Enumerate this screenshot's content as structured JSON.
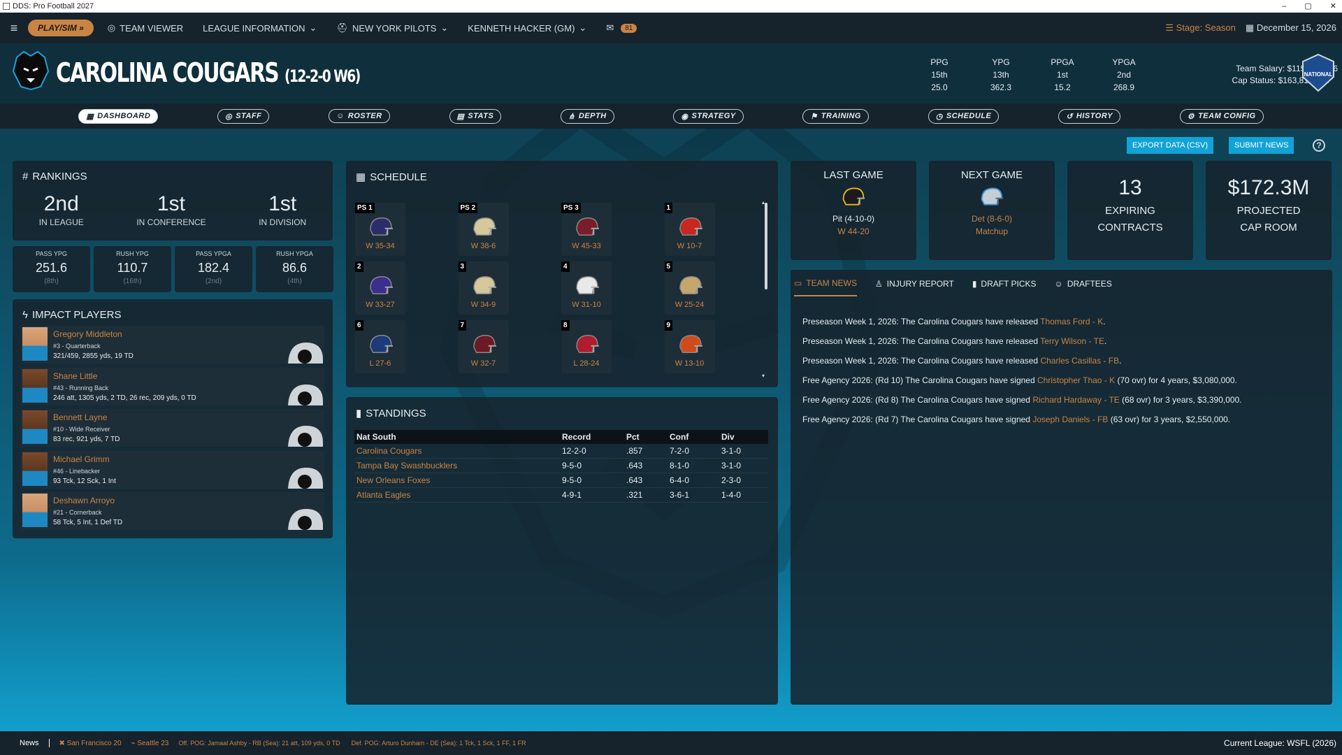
{
  "window": {
    "title": "DDS: Pro Football 2027"
  },
  "topnav": {
    "play_sim": "PLAY/SIM",
    "team_viewer": "TEAM VIEWER",
    "league_info": "LEAGUE INFORMATION",
    "user_team": "NEW YORK PILOTS",
    "gm": "KENNETH HACKER (GM)",
    "mail_count": "81",
    "stage": "Stage: Season",
    "date": "December 15, 2026"
  },
  "header": {
    "team_name": "CAROLINA COUGARS",
    "record": "(12-2-0 W6)",
    "stats": [
      {
        "label": "PPG",
        "rank": "15th",
        "value": "25.0"
      },
      {
        "label": "YPG",
        "rank": "13th",
        "value": "362.3"
      },
      {
        "label": "PPGA",
        "rank": "1st",
        "value": "15.2"
      },
      {
        "label": "YPGA",
        "rank": "2nd",
        "value": "268.9"
      }
    ],
    "team_salary": "Team Salary: $115,186,806",
    "cap_status": "Cap Status: $163,813,194",
    "conference_badge": "NATIONAL"
  },
  "subnav": [
    "DASHBOARD",
    "STAFF",
    "ROSTER",
    "STATS",
    "DEPTH",
    "STRATEGY",
    "TRAINING",
    "SCHEDULE",
    "HISTORY",
    "TEAM CONFIG"
  ],
  "actions": {
    "export": "EXPORT DATA (CSV)",
    "submit": "SUBMIT NEWS",
    "help": "?"
  },
  "rankings": {
    "title": "RANKINGS",
    "items": [
      {
        "value": "2nd",
        "label": "IN LEAGUE"
      },
      {
        "value": "1st",
        "label": "IN CONFERENCE"
      },
      {
        "value": "1st",
        "label": "IN DIVISION"
      }
    ],
    "mini": [
      {
        "label": "PASS YPG",
        "value": "251.6",
        "rank": "(8th)"
      },
      {
        "label": "RUSH YPG",
        "value": "110.7",
        "rank": "(16th)"
      },
      {
        "label": "PASS YPGA",
        "value": "182.4",
        "rank": "(2nd)"
      },
      {
        "label": "RUSH YPGA",
        "value": "86.6",
        "rank": "(4th)"
      }
    ]
  },
  "impact": {
    "title": "IMPACT PLAYERS",
    "players": [
      {
        "name": "Gregory Middleton",
        "pos": "#3 - Quarterback",
        "stats": "321/459, 2855 yds, 19 TD"
      },
      {
        "name": "Shane Little",
        "pos": "#43 - Running Back",
        "stats": "246 att, 1305 yds, 2 TD, 26 rec, 209 yds, 0 TD"
      },
      {
        "name": "Bennett Layne",
        "pos": "#10 - Wide Receiver",
        "stats": "83 rec, 921 yds, 7 TD"
      },
      {
        "name": "Michael Grimm",
        "pos": "#46 - Linebacker",
        "stats": "93 Tck, 12 Sck, 1 Int"
      },
      {
        "name": "Deshawn Arroyo",
        "pos": "#21 - Cornerback",
        "stats": "58 Tck, 5 Int, 1 Def TD"
      }
    ]
  },
  "schedule": {
    "title": "SCHEDULE",
    "games": [
      {
        "wk": "PS 1",
        "res": "W 35-34",
        "c": "#2b2d6b"
      },
      {
        "wk": "PS 2",
        "res": "W 38-6",
        "c": "#d5c89a"
      },
      {
        "wk": "PS 3",
        "res": "W 45-33",
        "c": "#7a1d2a"
      },
      {
        "wk": "1",
        "res": "W 10-7",
        "c": "#c8281e"
      },
      {
        "wk": "2",
        "res": "W 33-27",
        "c": "#3c2e8f"
      },
      {
        "wk": "3",
        "res": "W 34-9",
        "c": "#d5c89a"
      },
      {
        "wk": "4",
        "res": "W 31-10",
        "c": "#e9e9e9"
      },
      {
        "wk": "5",
        "res": "W 25-24",
        "c": "#c7a66b"
      },
      {
        "wk": "6",
        "res": "L 27-6",
        "c": "#1d3a7a"
      },
      {
        "wk": "7",
        "res": "W 32-7",
        "c": "#6b1a26"
      },
      {
        "wk": "8",
        "res": "L 28-24",
        "c": "#b01c2e"
      },
      {
        "wk": "9",
        "res": "W 13-10",
        "c": "#d14a1c"
      }
    ]
  },
  "standings": {
    "title": "STANDINGS",
    "headers": [
      "Nat South",
      "Record",
      "Pct",
      "Conf",
      "Div"
    ],
    "rows": [
      [
        "Carolina Cougars",
        "12-2-0",
        ".857",
        "7-2-0",
        "3-1-0"
      ],
      [
        "Tampa Bay Swashbucklers",
        "9-5-0",
        ".643",
        "8-1-0",
        "3-1-0"
      ],
      [
        "New Orleans Foxes",
        "9-5-0",
        ".643",
        "6-4-0",
        "2-3-0"
      ],
      [
        "Atlanta Eagles",
        "4-9-1",
        ".321",
        "3-6-1",
        "1-4-0"
      ]
    ]
  },
  "last_game": {
    "title": "LAST GAME",
    "team": "Pit (4-10-0)",
    "result": "W 44-20"
  },
  "next_game": {
    "title": "NEXT GAME",
    "team": "Det (8-6-0)",
    "link": "Matchup"
  },
  "expiring": {
    "value": "13",
    "line1": "EXPIRING",
    "line2": "CONTRACTS"
  },
  "cap_room": {
    "value": "$172.3M",
    "line1": "PROJECTED",
    "line2": "CAP ROOM"
  },
  "news_tabs": [
    "TEAM NEWS",
    "INJURY REPORT",
    "DRAFT PICKS",
    "DRAFTEES"
  ],
  "news": [
    {
      "pre": "Preseason Week 1, 2026: The Carolina Cougars have released ",
      "link": "Thomas Ford - K",
      "post": "."
    },
    {
      "pre": "Preseason Week 1, 2026: The Carolina Cougars have released ",
      "link": "Terry Wilson - TE",
      "post": "."
    },
    {
      "pre": "Preseason Week 1, 2026: The Carolina Cougars have released ",
      "link": "Charles Casillas - FB",
      "post": "."
    },
    {
      "pre": "Free Agency 2026: (Rd 10) The Carolina Cougars have signed ",
      "link": "Christopher Thao - K",
      "post": " (70 ovr) for 4 years, $3,080,000."
    },
    {
      "pre": "Free Agency 2026: (Rd 8) The Carolina Cougars have signed ",
      "link": "Richard Hardaway - TE",
      "post": " (68 ovr) for 3 years, $3,390,000."
    },
    {
      "pre": "Free Agency 2026: (Rd 7) The Carolina Cougars have signed ",
      "link": "Joseph Daniels - FB",
      "post": " (63 ovr) for 3 years, $2,550,000."
    }
  ],
  "bottom": {
    "news_label": "News",
    "score1": "San Francisco 20",
    "score2": "Seattle 23",
    "off_pog": "Off. POG: Jamaal Ashby - RB (Sea): 21 att, 109 yds, 0 TD",
    "def_pog": "Def. POG: Arturo Dunham - DE (Sea): 1 Tck, 1 Sck, 1 FF, 1 FR",
    "current_league": "Current League: WSFL (2026)"
  }
}
